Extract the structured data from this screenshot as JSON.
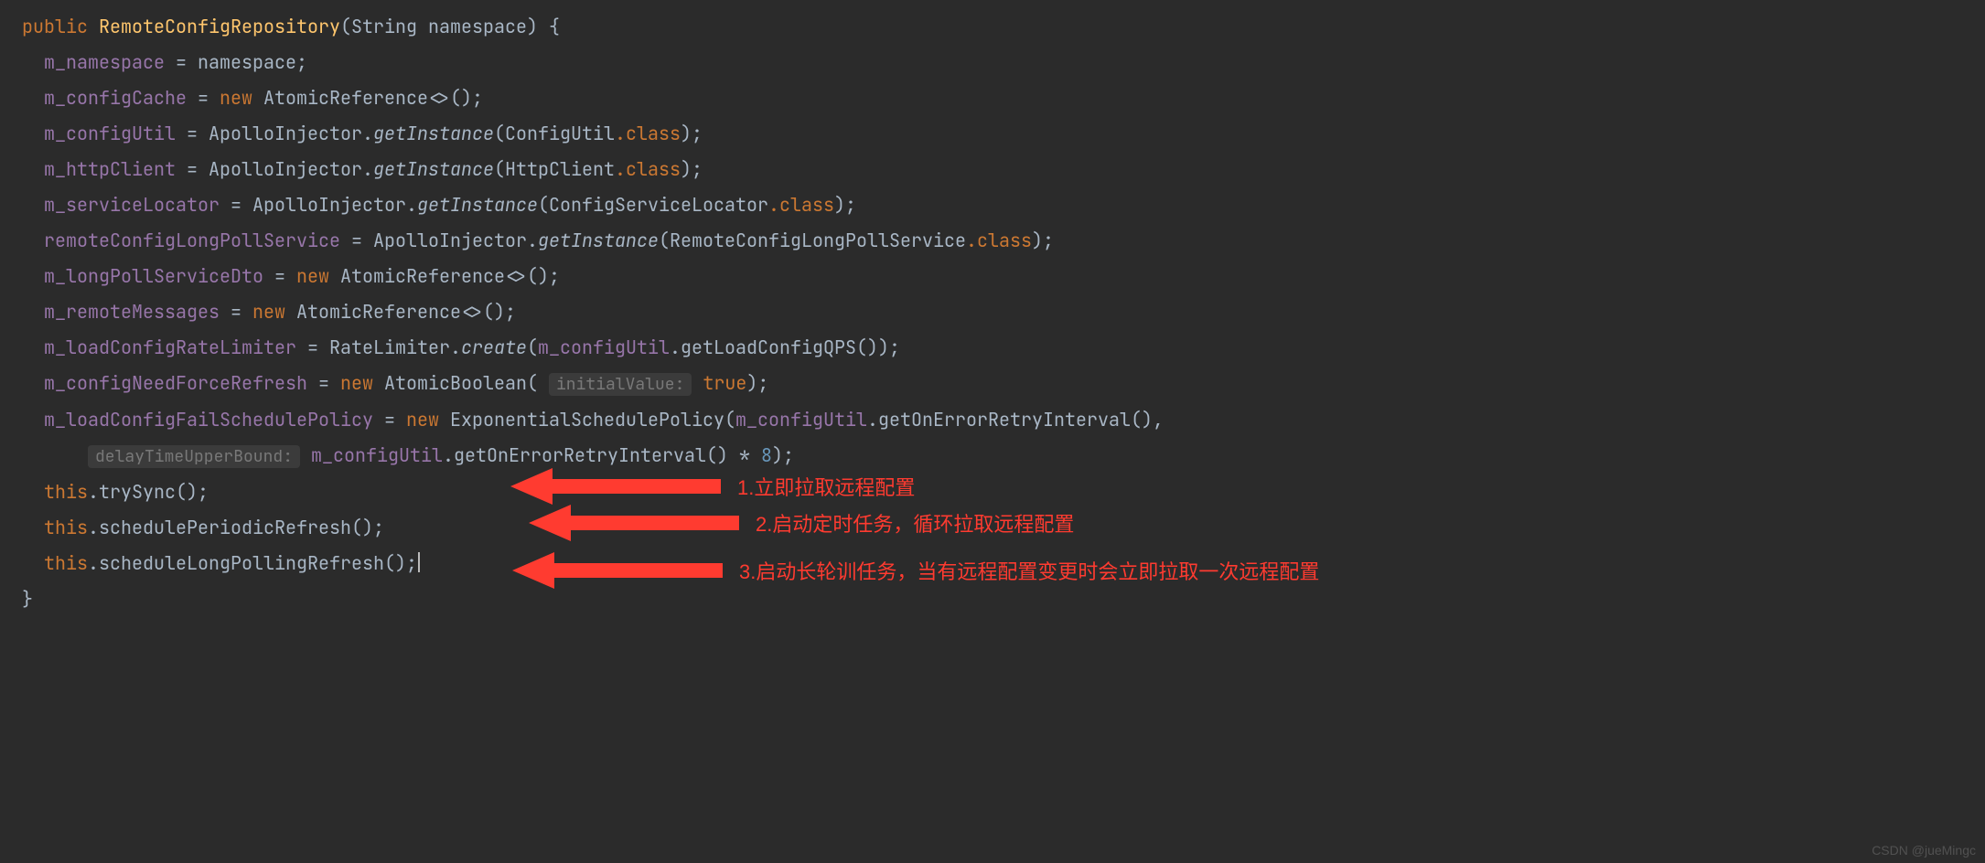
{
  "code": {
    "kw_public": "public",
    "constructor_name": "RemoteConfigRepository",
    "param_type": "String",
    "param_name": "namespace",
    "brace_open": " {",
    "f_namespace": "m_namespace",
    "eq_namespace": "namespace",
    "f_configCache": "m_configCache",
    "kw_new": "new",
    "AtomicReference": "AtomicReference<>()",
    "f_configUtil": "m_configUtil",
    "ApolloInjector": "ApolloInjector",
    "getInstance": "getInstance",
    "ConfigUtil_class": "ConfigUtil",
    "dot_class": ".class",
    "f_httpClient": "m_httpClient",
    "HttpClient_class": "HttpClient",
    "f_serviceLocator": "m_serviceLocator",
    "ConfigServiceLocator_class": "ConfigServiceLocator",
    "f_remoteConfigLongPollService": "remoteConfigLongPollService",
    "RemoteConfigLongPollService_class": "RemoteConfigLongPollService",
    "f_longPollServiceDto": "m_longPollServiceDto",
    "f_remoteMessages": "m_remoteMessages",
    "f_loadConfigRateLimiter": "m_loadConfigRateLimiter",
    "RateLimiter": "RateLimiter",
    "create": "create",
    "m_configUtil_ref": "m_configUtil",
    "getLoadConfigQPS": "getLoadConfigQPS()",
    "f_configNeedForceRefresh": "m_configNeedForceRefresh",
    "AtomicBoolean": "AtomicBoolean",
    "hint_initialValue": "initialValue:",
    "true_lit": "true",
    "f_loadConfigFailSchedulePolicy": "m_loadConfigFailSchedulePolicy",
    "ExponentialSchedulePolicy": "ExponentialSchedulePolicy",
    "getOnErrorRetryInterval": "getOnErrorRetryInterval()",
    "hint_delayTimeUpperBound": "delayTimeUpperBound:",
    "num_8": "8",
    "this_kw": "this",
    "trySync": "trySync()",
    "schedulePeriodicRefresh": "schedulePeriodicRefresh()",
    "scheduleLongPollingRefresh": "scheduleLongPollingRefresh()"
  },
  "annotations": {
    "a1": "1.立即拉取远程配置",
    "a2": "2.启动定时任务，循环拉取远程配置",
    "a3": "3.启动长轮训任务，当有远程配置变更时会立即拉取一次远程配置"
  },
  "watermark": "CSDN @jueMingc"
}
